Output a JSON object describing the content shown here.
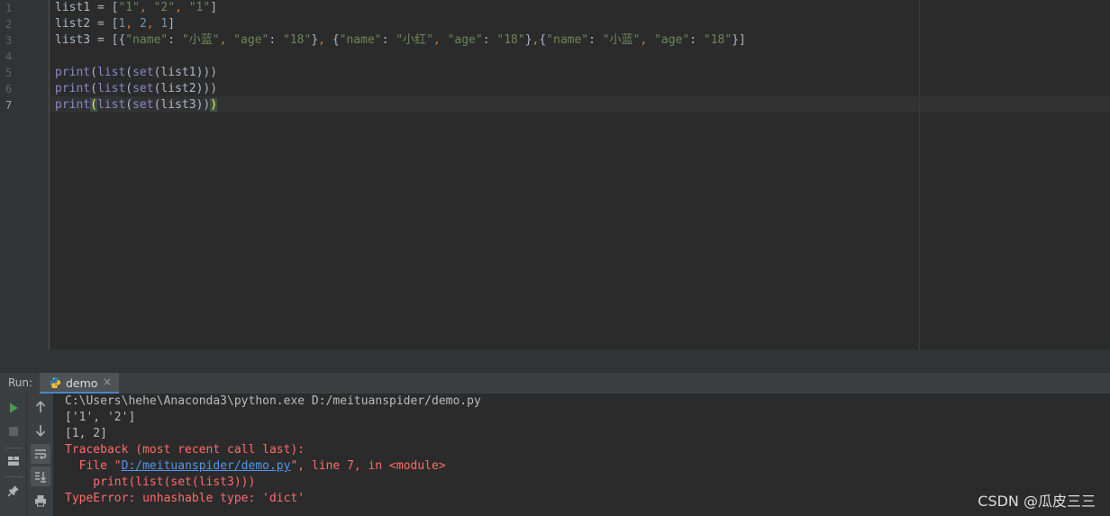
{
  "editor": {
    "line_numbers": [
      "1",
      "2",
      "3",
      "4",
      "5",
      "6",
      "7"
    ],
    "tokens": {
      "list1": "list1",
      "list2": "list2",
      "list3": "list3",
      "eq": " = ",
      "lb": "[",
      "rb": "]",
      "lc": "{",
      "rc": "}",
      "comma": ", ",
      "colon": ": ",
      "s1": "\"1\"",
      "s2": "\"2\"",
      "n1": "1",
      "n2": "2",
      "k_name": "\"name\"",
      "k_age": "\"age\"",
      "v_xiaolan": "\"小蓝\"",
      "v_xiaohong": "\"小红\"",
      "v_18": "\"18\"",
      "comma_tight": ",",
      "print": "print",
      "list": "list",
      "set": "set",
      "lp": "(",
      "rp": ")",
      "rpp": "))"
    }
  },
  "run": {
    "label": "Run:",
    "tab_label": "demo",
    "tab_close": "×",
    "console": {
      "line1": "C:\\Users\\hehe\\Anaconda3\\python.exe D:/meituanspider/demo.py",
      "line2": "['1', '2']",
      "line3": "[1, 2]",
      "line4": "Traceback (most recent call last):",
      "line5_pre": "  File \"",
      "line5_link": "D:/meituanspider/demo.py",
      "line5_post": "\", line 7, in <module>",
      "line6": "    print(list(set(list3)))",
      "line7": "TypeError: unhashable type: 'dict'"
    }
  },
  "watermark": "CSDN @瓜皮三三",
  "colors": {
    "editor_bg": "#2b2b2b",
    "string": "#6a8759",
    "number": "#6897bb",
    "keyword_punct": "#cc7832",
    "builtin": "#8888c6",
    "error": "#ff6b68",
    "link": "#5394ec",
    "run_green": "#499c54"
  },
  "icons": {
    "tab": "python-icon",
    "toolbar_left": [
      "rerun-icon",
      "stop-icon",
      "layout-icon",
      "pin-icon"
    ],
    "toolbar_right": [
      "up-arrow-icon",
      "down-arrow-icon",
      "soft-wrap-icon",
      "scroll-to-end-icon",
      "print-icon"
    ]
  }
}
